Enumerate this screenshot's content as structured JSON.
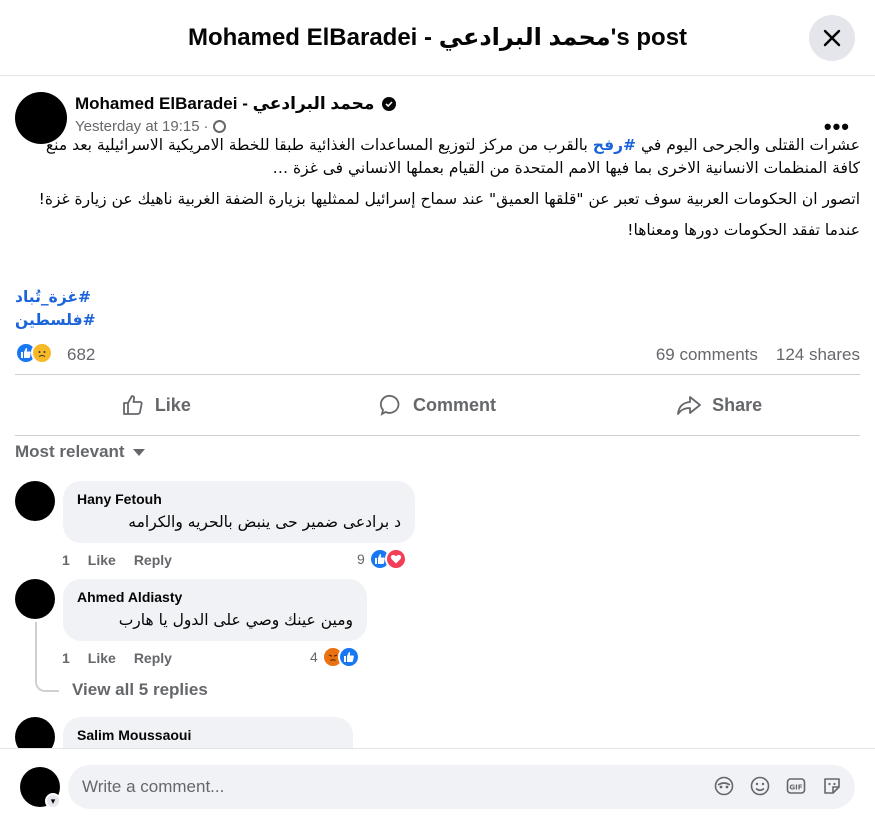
{
  "header": {
    "title": "Mohamed ElBaradei - محمد البرادعي's post"
  },
  "post": {
    "author": "Mohamed ElBaradei - محمد البرادعي",
    "timestamp": "Yesterday at 19:15",
    "separator": "·",
    "paragraph1_pre": "عشرات القتلى والجرحى اليوم في ",
    "paragraph1_hashtag": "#رفح",
    "paragraph1_post": " بالقرب من مركز لتوزيع المساعدات الغذائية طبقا للخطة الامريكية الاسرائيلية  بعد منع كافة المنظمات الانسانية الاخرى بما فيها الامم المتحدة من القيام بعملها الانساني فى غزة …",
    "paragraph2": "اتصور ان الحكومات العربية سوف تعبر عن \"قلقها العميق\" عند سماح إسرائيل لممثليها بزيارة الضفة الغربية ناهيك عن زيارة غزة!",
    "paragraph3": "عندما تفقد الحكومات دورها ومعناها!",
    "hashtags": [
      "#غزة_تُباد",
      "#فلسطين"
    ],
    "reaction_count": "682",
    "comments_count": "69 comments",
    "shares_count": "124 shares"
  },
  "actions": {
    "like": "Like",
    "comment": "Comment",
    "share": "Share"
  },
  "sort_label": "Most relevant",
  "comments": [
    {
      "name": "Hany Fetouh",
      "text": "د برادعى ضمير حى ينبض بالحريه والكرامه",
      "time": "1",
      "like": "Like",
      "reply": "Reply",
      "reactions": "9"
    },
    {
      "name": "Ahmed Aldiasty",
      "text": "ومين عينك وصي على الدول يا هارب",
      "time": "1",
      "like": "Like",
      "reply": "Reply",
      "reactions": "4"
    },
    {
      "name": "Salim Moussaoui"
    }
  ],
  "view_replies": "View all 5 replies",
  "composer": {
    "placeholder": "Write a comment..."
  },
  "colors": {
    "accent": "#1877f2",
    "hashtag": "#1b64d9",
    "muted": "#65676b",
    "bubble": "#f0f2f5"
  },
  "icons": [
    "close-icon",
    "verified-icon",
    "globe-icon",
    "more-icon",
    "like-icon",
    "comment-icon",
    "share-icon",
    "caret-down-icon",
    "avatar-icon",
    "emoji-icon",
    "gif-icon",
    "sticker-icon",
    "camera-icon"
  ]
}
